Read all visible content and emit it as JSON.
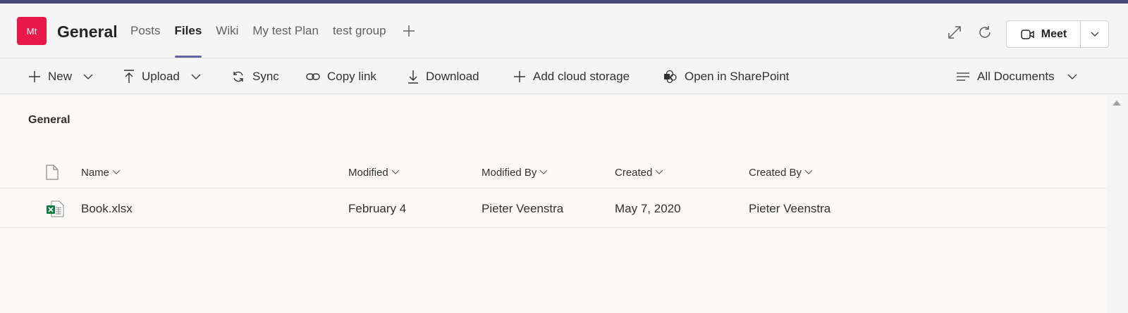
{
  "header": {
    "avatar_initials": "Mt",
    "avatar_color": "#e8194a",
    "channel_title": "General",
    "tabs": [
      {
        "label": "Posts",
        "active": false
      },
      {
        "label": "Files",
        "active": true
      },
      {
        "label": "Wiki",
        "active": false
      },
      {
        "label": "My test Plan",
        "active": false
      },
      {
        "label": "test group",
        "active": false
      }
    ],
    "add_tab_icon": "plus-icon",
    "expand_icon": "expand-icon",
    "refresh_icon": "refresh-icon",
    "meet_label": "Meet",
    "accent_color": "#6264a7"
  },
  "toolbar": {
    "new_label": "New",
    "upload_label": "Upload",
    "sync_label": "Sync",
    "copy_link_label": "Copy link",
    "download_label": "Download",
    "add_cloud_label": "Add cloud storage",
    "open_sharepoint_label": "Open in SharePoint",
    "view_label": "All Documents"
  },
  "content": {
    "section_title": "General",
    "columns": {
      "name": "Name",
      "modified": "Modified",
      "modified_by": "Modified By",
      "created": "Created",
      "created_by": "Created By"
    },
    "rows": [
      {
        "file_icon": "excel-file-icon",
        "name": "Book.xlsx",
        "modified": "February 4",
        "modified_by": "Pieter Veenstra",
        "created": "May 7, 2020",
        "created_by": "Pieter Veenstra"
      }
    ]
  }
}
